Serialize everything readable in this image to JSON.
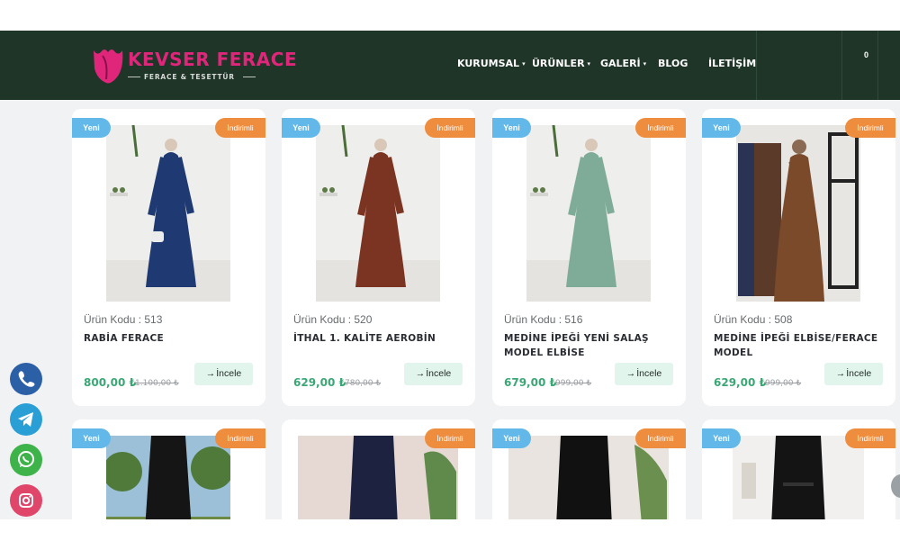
{
  "brand": {
    "name": "KEVSER FERACE",
    "tagline": "FERACE & TESETTÜR",
    "colors": {
      "primary": "#e0267b",
      "header_bg": "#1e3528"
    }
  },
  "nav": {
    "items": [
      {
        "label": "KURUMSAL",
        "has_dropdown": true
      },
      {
        "label": "ÜRÜNLER",
        "has_dropdown": true
      },
      {
        "label": "GALERİ",
        "has_dropdown": true
      },
      {
        "label": "BLOG",
        "has_dropdown": false
      },
      {
        "label": "İLETİŞİM",
        "has_dropdown": false
      }
    ],
    "caret_icon": "▾",
    "cart_count": "0"
  },
  "badges": {
    "new": "Yeni",
    "discount": "İndirimli"
  },
  "button_label": "İncele",
  "products": [
    {
      "code": "Ürün Kodu : 513",
      "title": "RABİA FERACE",
      "price": "800,00 ₺",
      "old_price": "1.100,00 ₺",
      "dress_color": "#1f3a72"
    },
    {
      "code": "Ürün Kodu : 520",
      "title": "İTHAL 1. KALİTE AEROBİN",
      "price": "629,00 ₺",
      "old_price": "780,00 ₺",
      "dress_color": "#7b3422"
    },
    {
      "code": "Ürün Kodu : 516",
      "title": "MEDİNE İPEĞİ YENİ SALAŞ MODEL ELBİSE",
      "price": "679,00 ₺",
      "old_price": "999,00 ₺",
      "dress_color": "#7fac98"
    },
    {
      "code": "Ürün Kodu : 508",
      "title": "MEDİNE İPEĞİ ELBİSE/FERACE MODEL",
      "price": "629,00 ₺",
      "old_price": "999,00 ₺",
      "dress_color": "#7a4a2a"
    }
  ],
  "products_row2": [
    {
      "dress_color": "#151515"
    },
    {
      "dress_color": "#1c2240"
    },
    {
      "dress_color": "#111111"
    },
    {
      "dress_color": "#141414"
    }
  ],
  "social": [
    {
      "icon": "phone-icon",
      "color": "#2b5fa6"
    },
    {
      "icon": "telegram-icon",
      "color": "#2a9fd6"
    },
    {
      "icon": "whatsapp-icon",
      "color": "#3db34a"
    },
    {
      "icon": "instagram-icon",
      "color": "#e0456a"
    }
  ]
}
